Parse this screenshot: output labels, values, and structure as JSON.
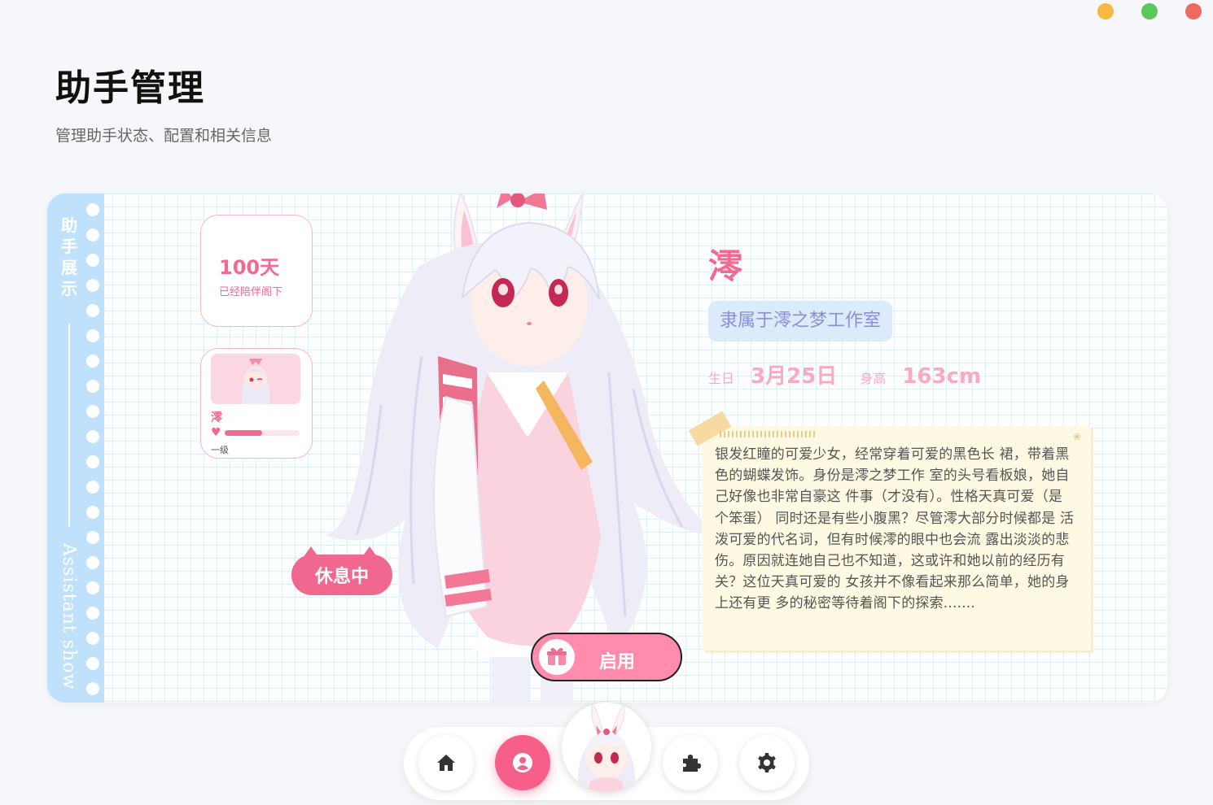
{
  "window_controls": {
    "minimize": "minimize",
    "maximize": "maximize",
    "close": "close"
  },
  "header": {
    "title": "助手管理",
    "subtitle": "管理助手状态、配置和相关信息"
  },
  "spine": {
    "title_cn": "助手展示",
    "title_en": "Assistant show"
  },
  "companion": {
    "days": "100天",
    "days_label": "已经陪伴阁下"
  },
  "mini_card": {
    "name": "澪",
    "level": "一级",
    "affection": 0.5
  },
  "status": {
    "label": "休息中"
  },
  "enable_button": {
    "label": "启用",
    "icon": "gift-icon"
  },
  "profile": {
    "name": "澪",
    "studio": "隶属于澪之梦工作室",
    "birthday_label": "生日",
    "birthday": "3月25日",
    "height_label": "身高",
    "height": "163cm"
  },
  "description": "银发红瞳的可爱少女，经常穿着可爱的黑色长 裙，带着黑色的蝴蝶发饰。身份是澪之梦工作 室的头号看板娘，她自己好像也非常自豪这 件事（才没有）。性格天真可爱（是个笨蛋） 同时还是有些小腹黑？尽管澪大部分时候都是 活泼可爱的代名词，但有时候澪的眼中也会流 露出淡淡的悲伤。原因就连她自己也不知道，这或许和她以前的经历有关？这位天真可爱的 女孩并不像看起来那么简单，她的身上还有更 多的秘密等待着阁下的探索.......",
  "dock": {
    "items": [
      {
        "icon": "home-icon",
        "active": false
      },
      {
        "icon": "user-icon",
        "active": true
      },
      {
        "icon": "avatar",
        "active": false
      },
      {
        "icon": "puzzle-icon",
        "active": false
      },
      {
        "icon": "gear-icon",
        "active": false
      }
    ]
  },
  "colors": {
    "accent": "#f06a92",
    "spine": "#bfe1fb",
    "studio_tag_bg": "#dcebfa",
    "studio_tag_text": "#8c8fd6",
    "note_bg": "#fdf9e2"
  }
}
